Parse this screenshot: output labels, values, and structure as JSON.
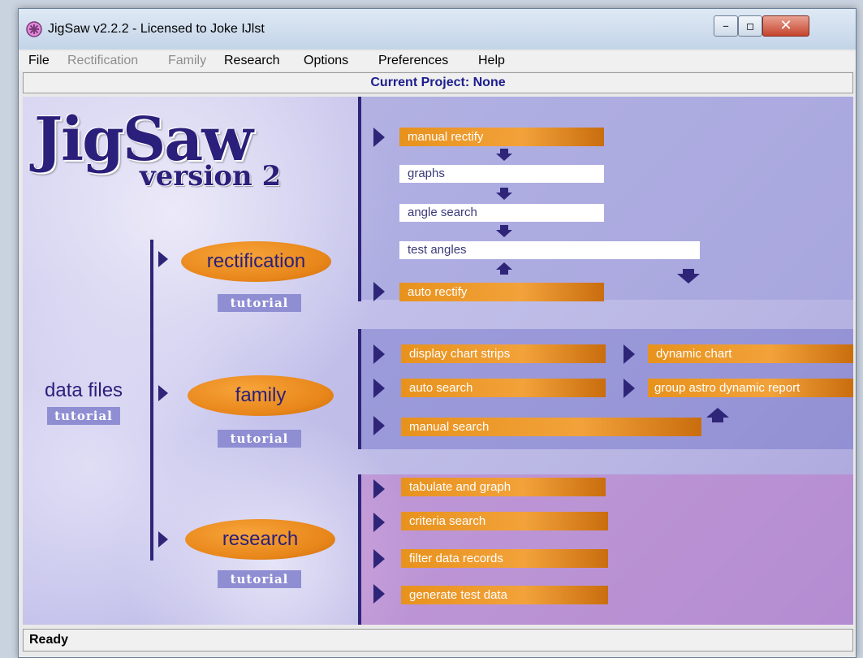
{
  "window": {
    "title": "JigSaw v2.2.2 - Licensed to Joke IJlst"
  },
  "menu": {
    "items": [
      {
        "label": "File",
        "enabled": true
      },
      {
        "label": "Rectification",
        "enabled": false
      },
      {
        "label": "Family",
        "enabled": false
      },
      {
        "label": "Research",
        "enabled": true
      },
      {
        "label": "Options",
        "enabled": true
      },
      {
        "label": "Preferences",
        "enabled": true
      },
      {
        "label": "Help",
        "enabled": true
      }
    ]
  },
  "project": {
    "label": "Current Project: None"
  },
  "logo": {
    "title": "JigSaw",
    "subtitle": "version 2"
  },
  "left": {
    "data_files": "data files",
    "tutorial": "tutorial",
    "rectification": "rectification",
    "family": "family",
    "research": "research"
  },
  "rectification_panel": {
    "manual_rectify": "manual rectify",
    "graphs": "graphs",
    "angle_search": "angle search",
    "test_angles": "test angles",
    "auto_rectify": "auto rectify"
  },
  "family_panel": {
    "display_chart_strips": "display chart strips",
    "auto_search": "auto search",
    "manual_search": "manual search",
    "dynamic_chart": "dynamic chart",
    "group_astro_dynamic_report": "group astro dynamic report"
  },
  "research_panel": {
    "tabulate_and_graph": "tabulate and graph",
    "criteria_search": "criteria search",
    "filter_data_records": "filter data records",
    "generate_test_data": "generate test data"
  },
  "status": {
    "text": "Ready"
  },
  "colors": {
    "accent_orange": "#e8921d",
    "navy": "#2e2578",
    "panel_blue": "#b9b6e4"
  }
}
